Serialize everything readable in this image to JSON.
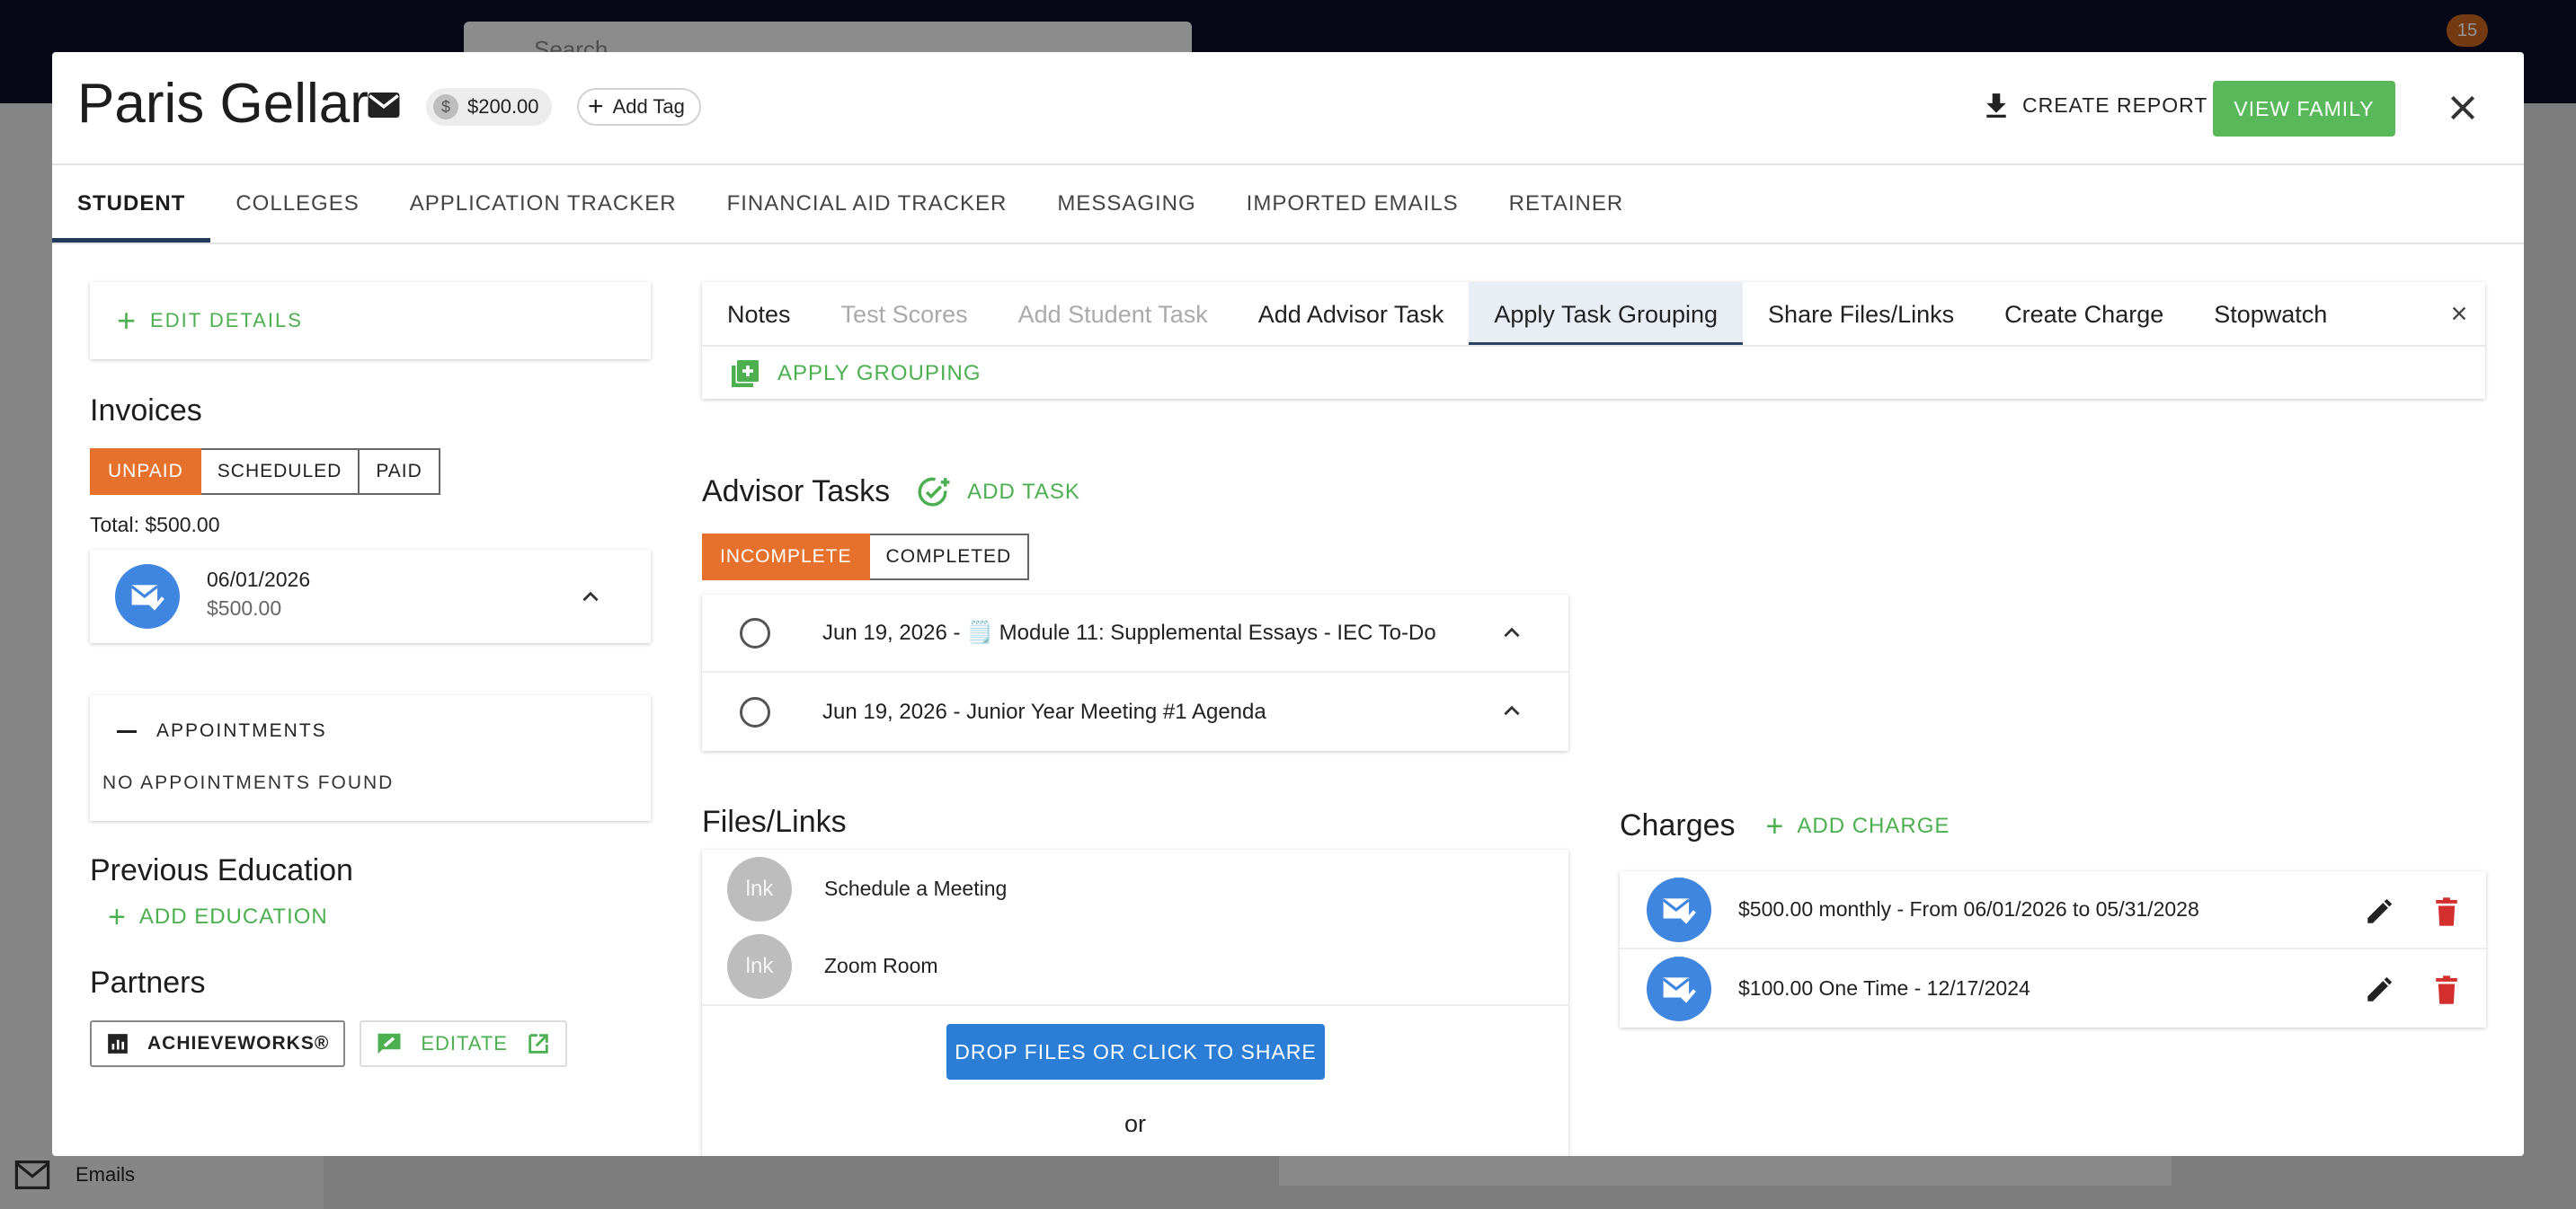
{
  "background": {
    "search_placeholder": "Search",
    "notification_count": "15",
    "sidebar_emails_label": "Emails"
  },
  "header": {
    "student_name": "Paris Gellar",
    "balance": "$200.00",
    "balance_symbol": "$",
    "add_tag_label": "Add Tag",
    "create_report_label": "CREATE REPORT",
    "view_family_label": "VIEW FAMILY"
  },
  "tabs": [
    {
      "label": "STUDENT",
      "active": true
    },
    {
      "label": "COLLEGES"
    },
    {
      "label": "APPLICATION TRACKER"
    },
    {
      "label": "FINANCIAL AID TRACKER"
    },
    {
      "label": "MESSAGING"
    },
    {
      "label": "IMPORTED EMAILS"
    },
    {
      "label": "RETAINER"
    }
  ],
  "left": {
    "edit_details_label": "EDIT DETAILS",
    "invoices_title": "Invoices",
    "invoice_filters": [
      "UNPAID",
      "SCHEDULED",
      "PAID"
    ],
    "total": "Total: $500.00",
    "invoice": {
      "date": "06/01/2026",
      "amount": "$500.00"
    },
    "appointments_label": "APPOINTMENTS",
    "no_appointments": "NO APPOINTMENTS FOUND",
    "previous_education_title": "Previous Education",
    "add_education_label": "ADD EDUCATION",
    "partners_title": "Partners",
    "partner_achieveworks": "ACHIEVEWORKS®",
    "partner_editate": "EDITATE"
  },
  "task_panel": {
    "tabs": [
      "Notes",
      "Test Scores",
      "Add Student Task",
      "Add Advisor Task",
      "Apply Task Grouping",
      "Share Files/Links",
      "Create Charge",
      "Stopwatch"
    ],
    "apply_grouping_label": "APPLY GROUPING"
  },
  "advisor_tasks": {
    "title": "Advisor Tasks",
    "add_task_label": "ADD TASK",
    "filters": [
      "INCOMPLETE",
      "COMPLETED"
    ],
    "tasks": [
      {
        "text": "Jun 19, 2026 - 🗒️ Module 11: Supplemental Essays - IEC To-Do"
      },
      {
        "text": "Jun 19, 2026 - Junior Year Meeting #1 Agenda"
      }
    ]
  },
  "files": {
    "title": "Files/Links",
    "items": [
      {
        "avatar": "lnk",
        "label": "Schedule a Meeting"
      },
      {
        "avatar": "lnk",
        "label": "Zoom Room"
      }
    ],
    "drop_label": "DROP FILES OR CLICK TO SHARE",
    "or_label": "or"
  },
  "charges": {
    "title": "Charges",
    "add_charge_label": "ADD CHARGE",
    "items": [
      {
        "text": "$500.00 monthly - From 06/01/2026 to 05/31/2028"
      },
      {
        "text": "$100.00 One Time - 12/17/2024"
      }
    ]
  },
  "colors": {
    "accent_green": "#59b85a",
    "accent_orange": "#e5712d",
    "accent_blue": "#2b7dd6",
    "delete_red": "#d32f2f"
  }
}
